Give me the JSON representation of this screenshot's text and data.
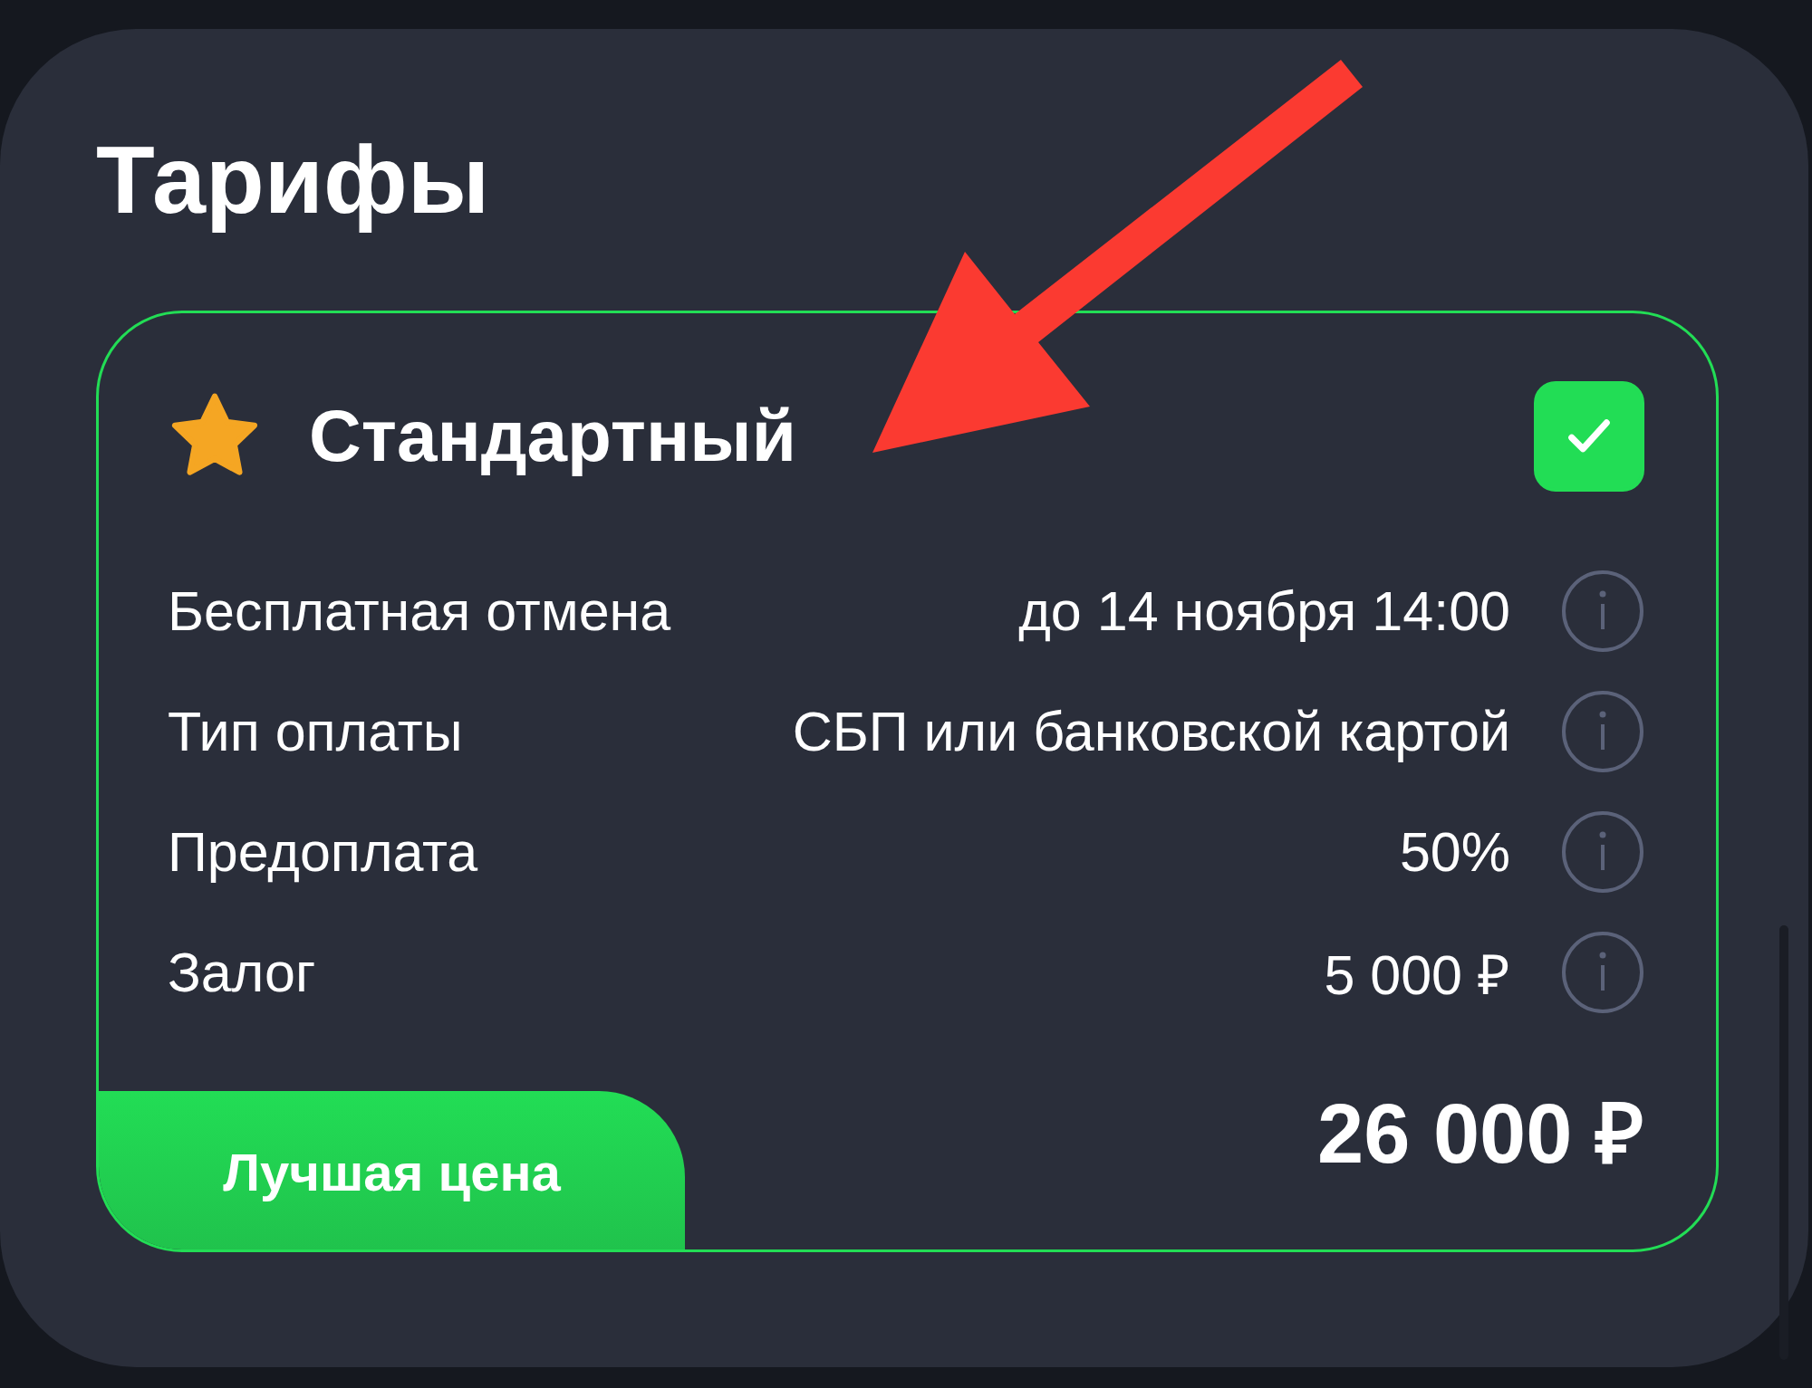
{
  "title": "Тарифы",
  "tariff": {
    "name": "Стандартный",
    "selected": true,
    "rows": [
      {
        "label": "Бесплатная отмена",
        "value": "до 14 ноября 14:00"
      },
      {
        "label": "Тип оплаты",
        "value": "СБП или банковской картой"
      },
      {
        "label": "Предоплата",
        "value": "50%"
      },
      {
        "label": "Залог",
        "value": "5 000 ₽"
      }
    ],
    "badge": "Лучшая цена",
    "price": "26 000 ₽"
  }
}
